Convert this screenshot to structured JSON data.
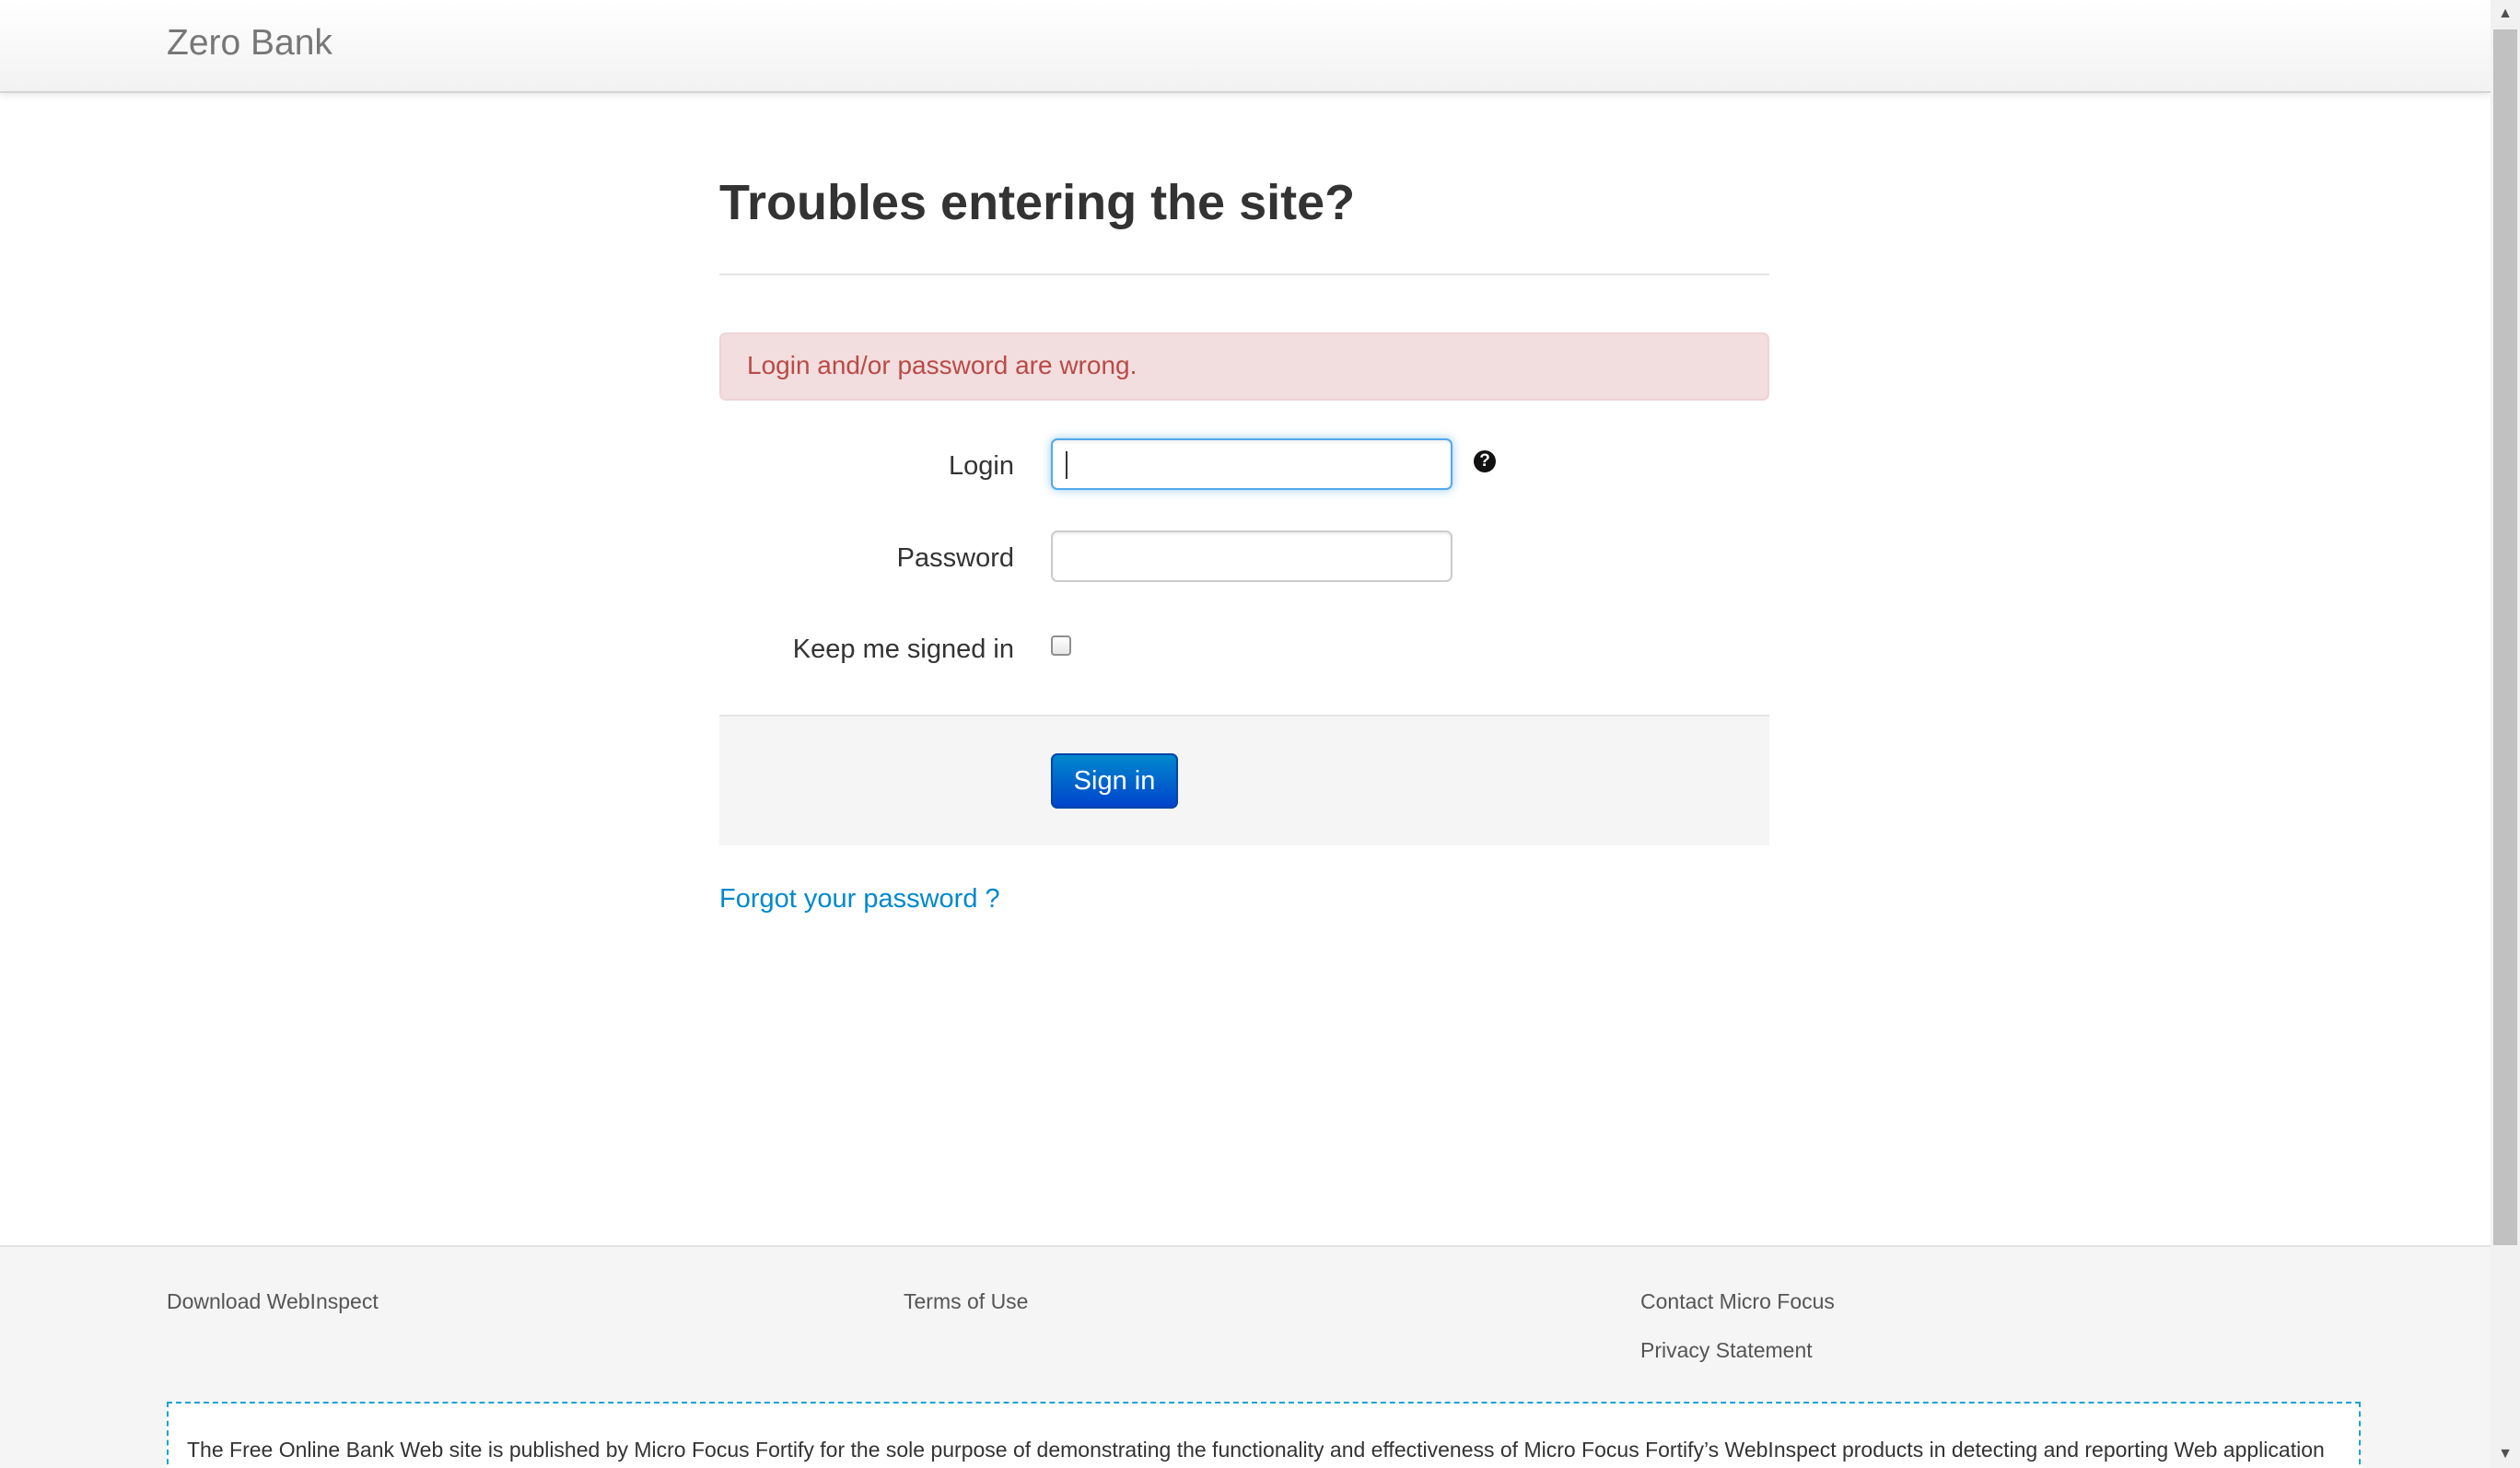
{
  "navbar": {
    "brand": "Zero Bank"
  },
  "main": {
    "title": "Troubles entering the site?",
    "alert": "Login and/or password are wrong.",
    "login_label": "Login",
    "login_value": "",
    "password_label": "Password",
    "password_value": "",
    "help_icon": "question-circle-icon",
    "keep_signed_label": "Keep me signed in",
    "keep_signed_checked": false,
    "signin_button": "Sign in",
    "forgot_link": "Forgot your password ?"
  },
  "footer": {
    "col1": [
      "Download WebInspect"
    ],
    "col2": [
      "Terms of Use"
    ],
    "col3": [
      "Contact Micro Focus",
      "Privacy Statement"
    ],
    "disclaimer": "The Free Online Bank Web site is published by Micro Focus Fortify for the sole purpose of demonstrating the functionality and effectiveness of Micro Focus Fortify’s WebInspect products in detecting and reporting Web application"
  },
  "colors": {
    "alert_bg": "#f2dede",
    "alert_text": "#b94a48",
    "primary_button": "#0055cc",
    "link": "#0088cc",
    "focus_border": "#52a8ec"
  }
}
